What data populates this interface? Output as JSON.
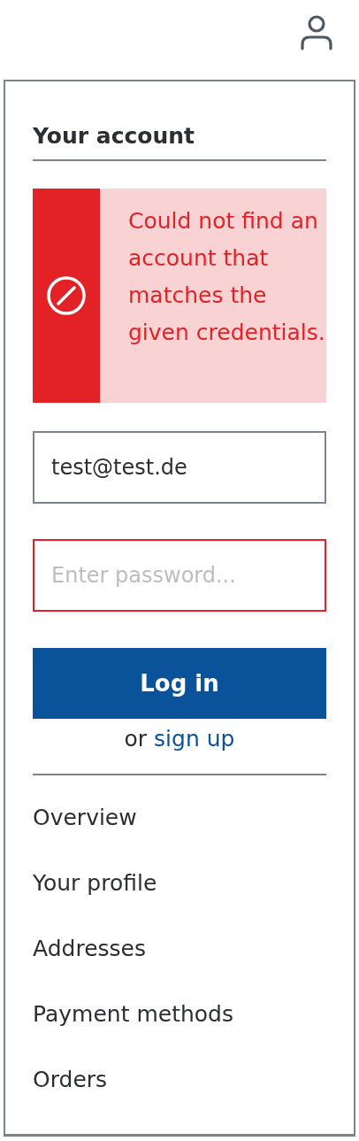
{
  "panel": {
    "title": "Your account",
    "error": {
      "message": "Could not find an account that matches the given credentials."
    },
    "email": {
      "value": "test@test.de",
      "invalid": false
    },
    "password": {
      "placeholder": "Enter password...",
      "invalid": true
    },
    "login_button": "Log in",
    "signup": {
      "prefix": "or",
      "link": "sign up"
    },
    "menu": [
      "Overview",
      "Your profile",
      "Addresses",
      "Payment methods",
      "Orders"
    ]
  }
}
